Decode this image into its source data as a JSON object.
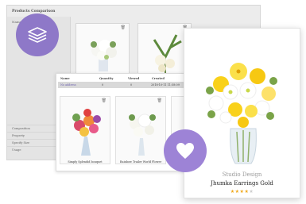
{
  "comparison": {
    "title": "Products Comparison",
    "name_label": "Name",
    "attribute_rows": [
      "Composition",
      "Property",
      "Specify Size",
      "Usage"
    ]
  },
  "table": {
    "headers": [
      "Name",
      "Quantity",
      "Viewed",
      "Created"
    ],
    "row": [
      "No address",
      "0",
      "0",
      "2018-10-11 11:58:09"
    ]
  },
  "mid_products": [
    {
      "label": "Simply Splendid bouquet"
    },
    {
      "label": "Rainbow Trailer World Flower"
    }
  ],
  "product": {
    "brand": "Studio Design",
    "name": "Jhumka Earrings Gold",
    "rating": 4,
    "rating_max": 5
  },
  "icons": [
    "layers-icon",
    "heart-icon",
    "trash-icon"
  ],
  "colors": {
    "accent": "#8e78c8",
    "star": "#f0a81a"
  }
}
